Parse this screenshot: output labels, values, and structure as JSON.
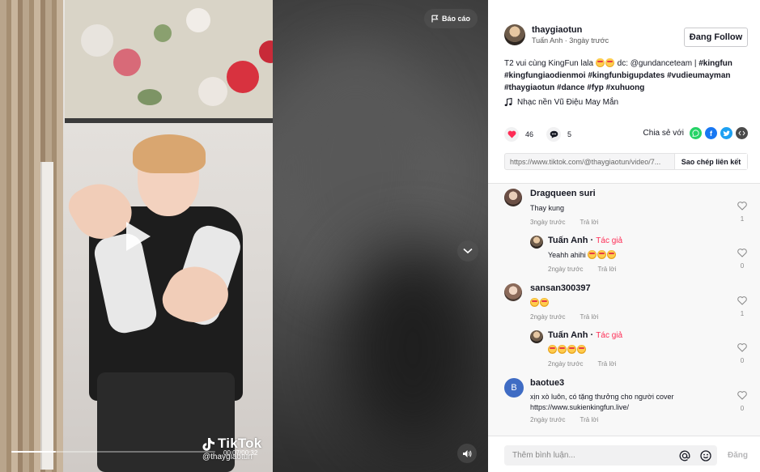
{
  "video": {
    "report_label": "Báo cáo",
    "watermark_brand": "TikTok",
    "watermark_user": "@thaygiaotun",
    "time_readout": "00:07/00:32",
    "progress": 0.22
  },
  "author": {
    "username": "thaygiaotun",
    "nickname": "Tuấn Anh",
    "posted": "3ngày trước",
    "follow_label": "Đang Follow"
  },
  "caption": {
    "text": "T2 vui cùng KingFun lala",
    "credit": "dc: @gundanceteam |",
    "hashtags": [
      "#kingfun",
      "#kingfungiaodienmoi",
      "#kingfunbigupdates",
      "#vudieumayman",
      "#thaygiaotun",
      "#dance",
      "#fyp",
      "#xuhuong"
    ]
  },
  "music": {
    "title": "Nhạc nền Vũ Điệu May Mắn"
  },
  "stats": {
    "likes": "46",
    "comments": "5",
    "share_label": "Chia sẻ với"
  },
  "link": {
    "url": "https://www.tiktok.com/@thaygiaotun/video/7...",
    "copy_label": "Sao chép liên kết"
  },
  "comments": [
    {
      "user": "Dragqueen suri",
      "text": "Thay kung",
      "emojis": 0,
      "time": "3ngày trước",
      "reply": "Trả lời",
      "likes": "1",
      "is_author": false
    },
    {
      "user": "Tuấn Anh",
      "author_tag": "Tác giả",
      "text": "Yeahh ahihi",
      "emojis": 3,
      "time": "2ngày trước",
      "reply": "Trả lời",
      "likes": "0",
      "is_author": true
    },
    {
      "user": "sansan300397",
      "text": "",
      "emojis": 2,
      "time": "2ngày trước",
      "reply": "Trả lời",
      "likes": "1",
      "is_author": false
    },
    {
      "user": "Tuấn Anh",
      "author_tag": "Tác giả",
      "text": "",
      "emojis": 4,
      "time": "2ngày trước",
      "reply": "Trả lời",
      "likes": "0",
      "is_author": true
    },
    {
      "user": "baotue3",
      "avatar_letter": "B",
      "text": "xịn xò luôn, có tặng thưởng cho người cover",
      "text2": "https://www.sukienkingfun.live/",
      "time": "2ngày trước",
      "reply": "Trả lời",
      "likes": "0",
      "is_author": false
    }
  ],
  "comment_bar": {
    "placeholder": "Thêm bình luận...",
    "post_label": "Đăng"
  },
  "colors": {
    "accent": "#fe2c55",
    "like_heart": "#fe2c55",
    "whatsapp": "#25d366",
    "facebook": "#1877f2",
    "twitter": "#1da1f2",
    "embed": "#4b4b4b",
    "avatar_b": "#3f6cc4"
  },
  "icons": {
    "report": "flag-icon",
    "play": "play-icon",
    "down": "chevron-down-icon",
    "volume": "speaker-icon",
    "music": "music-note-icon",
    "like": "heart-icon",
    "comment": "comment-icon",
    "mention": "at-icon",
    "emoji": "smile-icon"
  }
}
